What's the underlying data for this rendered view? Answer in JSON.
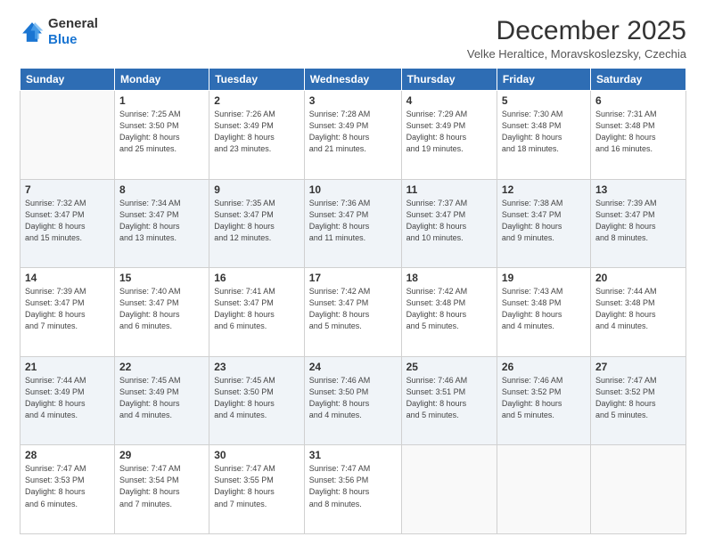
{
  "logo": {
    "general": "General",
    "blue": "Blue"
  },
  "header": {
    "month": "December 2025",
    "location": "Velke Heraltice, Moravskoslezsky, Czechia"
  },
  "weekdays": [
    "Sunday",
    "Monday",
    "Tuesday",
    "Wednesday",
    "Thursday",
    "Friday",
    "Saturday"
  ],
  "weeks": [
    [
      {
        "day": "",
        "info": ""
      },
      {
        "day": "1",
        "info": "Sunrise: 7:25 AM\nSunset: 3:50 PM\nDaylight: 8 hours\nand 25 minutes."
      },
      {
        "day": "2",
        "info": "Sunrise: 7:26 AM\nSunset: 3:49 PM\nDaylight: 8 hours\nand 23 minutes."
      },
      {
        "day": "3",
        "info": "Sunrise: 7:28 AM\nSunset: 3:49 PM\nDaylight: 8 hours\nand 21 minutes."
      },
      {
        "day": "4",
        "info": "Sunrise: 7:29 AM\nSunset: 3:49 PM\nDaylight: 8 hours\nand 19 minutes."
      },
      {
        "day": "5",
        "info": "Sunrise: 7:30 AM\nSunset: 3:48 PM\nDaylight: 8 hours\nand 18 minutes."
      },
      {
        "day": "6",
        "info": "Sunrise: 7:31 AM\nSunset: 3:48 PM\nDaylight: 8 hours\nand 16 minutes."
      }
    ],
    [
      {
        "day": "7",
        "info": "Sunrise: 7:32 AM\nSunset: 3:47 PM\nDaylight: 8 hours\nand 15 minutes."
      },
      {
        "day": "8",
        "info": "Sunrise: 7:34 AM\nSunset: 3:47 PM\nDaylight: 8 hours\nand 13 minutes."
      },
      {
        "day": "9",
        "info": "Sunrise: 7:35 AM\nSunset: 3:47 PM\nDaylight: 8 hours\nand 12 minutes."
      },
      {
        "day": "10",
        "info": "Sunrise: 7:36 AM\nSunset: 3:47 PM\nDaylight: 8 hours\nand 11 minutes."
      },
      {
        "day": "11",
        "info": "Sunrise: 7:37 AM\nSunset: 3:47 PM\nDaylight: 8 hours\nand 10 minutes."
      },
      {
        "day": "12",
        "info": "Sunrise: 7:38 AM\nSunset: 3:47 PM\nDaylight: 8 hours\nand 9 minutes."
      },
      {
        "day": "13",
        "info": "Sunrise: 7:39 AM\nSunset: 3:47 PM\nDaylight: 8 hours\nand 8 minutes."
      }
    ],
    [
      {
        "day": "14",
        "info": "Sunrise: 7:39 AM\nSunset: 3:47 PM\nDaylight: 8 hours\nand 7 minutes."
      },
      {
        "day": "15",
        "info": "Sunrise: 7:40 AM\nSunset: 3:47 PM\nDaylight: 8 hours\nand 6 minutes."
      },
      {
        "day": "16",
        "info": "Sunrise: 7:41 AM\nSunset: 3:47 PM\nDaylight: 8 hours\nand 6 minutes."
      },
      {
        "day": "17",
        "info": "Sunrise: 7:42 AM\nSunset: 3:47 PM\nDaylight: 8 hours\nand 5 minutes."
      },
      {
        "day": "18",
        "info": "Sunrise: 7:42 AM\nSunset: 3:48 PM\nDaylight: 8 hours\nand 5 minutes."
      },
      {
        "day": "19",
        "info": "Sunrise: 7:43 AM\nSunset: 3:48 PM\nDaylight: 8 hours\nand 4 minutes."
      },
      {
        "day": "20",
        "info": "Sunrise: 7:44 AM\nSunset: 3:48 PM\nDaylight: 8 hours\nand 4 minutes."
      }
    ],
    [
      {
        "day": "21",
        "info": "Sunrise: 7:44 AM\nSunset: 3:49 PM\nDaylight: 8 hours\nand 4 minutes."
      },
      {
        "day": "22",
        "info": "Sunrise: 7:45 AM\nSunset: 3:49 PM\nDaylight: 8 hours\nand 4 minutes."
      },
      {
        "day": "23",
        "info": "Sunrise: 7:45 AM\nSunset: 3:50 PM\nDaylight: 8 hours\nand 4 minutes."
      },
      {
        "day": "24",
        "info": "Sunrise: 7:46 AM\nSunset: 3:50 PM\nDaylight: 8 hours\nand 4 minutes."
      },
      {
        "day": "25",
        "info": "Sunrise: 7:46 AM\nSunset: 3:51 PM\nDaylight: 8 hours\nand 5 minutes."
      },
      {
        "day": "26",
        "info": "Sunrise: 7:46 AM\nSunset: 3:52 PM\nDaylight: 8 hours\nand 5 minutes."
      },
      {
        "day": "27",
        "info": "Sunrise: 7:47 AM\nSunset: 3:52 PM\nDaylight: 8 hours\nand 5 minutes."
      }
    ],
    [
      {
        "day": "28",
        "info": "Sunrise: 7:47 AM\nSunset: 3:53 PM\nDaylight: 8 hours\nand 6 minutes."
      },
      {
        "day": "29",
        "info": "Sunrise: 7:47 AM\nSunset: 3:54 PM\nDaylight: 8 hours\nand 7 minutes."
      },
      {
        "day": "30",
        "info": "Sunrise: 7:47 AM\nSunset: 3:55 PM\nDaylight: 8 hours\nand 7 minutes."
      },
      {
        "day": "31",
        "info": "Sunrise: 7:47 AM\nSunset: 3:56 PM\nDaylight: 8 hours\nand 8 minutes."
      },
      {
        "day": "",
        "info": ""
      },
      {
        "day": "",
        "info": ""
      },
      {
        "day": "",
        "info": ""
      }
    ]
  ]
}
